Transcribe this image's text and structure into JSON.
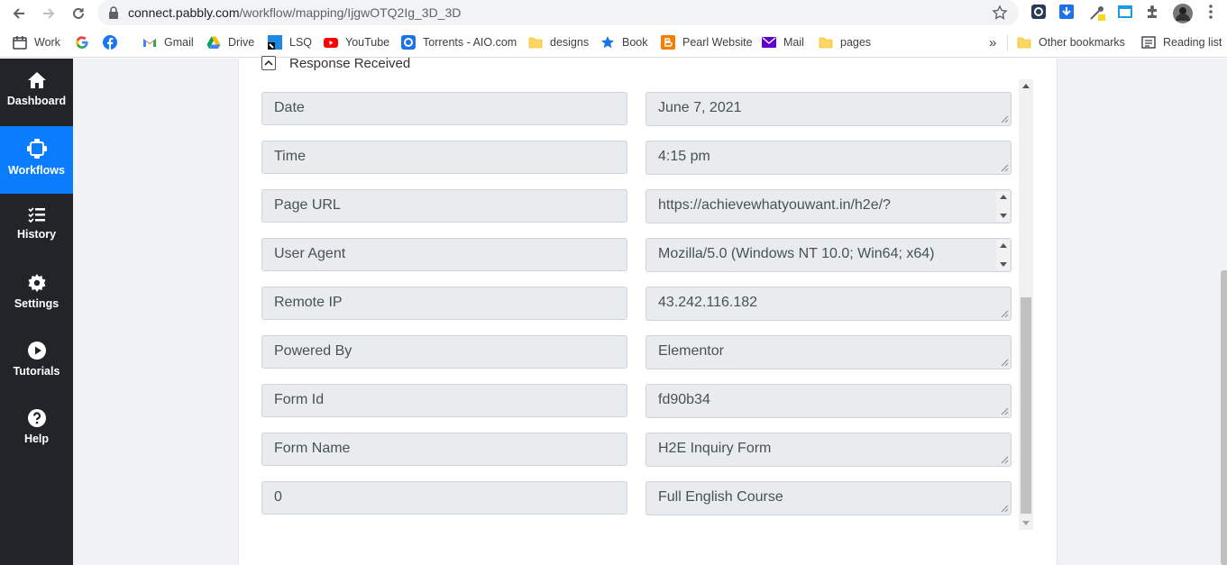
{
  "browser": {
    "url_host": "connect.pabbly.com",
    "url_path": "/workflow/mapping/IjgwOTQ2Ig_3D_3D",
    "bookmarks": [
      {
        "label": "Work",
        "icon": "calendar-icon"
      },
      {
        "label": "",
        "icon": "google-icon"
      },
      {
        "label": "",
        "icon": "facebook-icon"
      },
      {
        "label": "Gmail",
        "icon": "gmail-icon"
      },
      {
        "label": "Drive",
        "icon": "drive-icon"
      },
      {
        "label": "LSQ",
        "icon": "lsq-icon"
      },
      {
        "label": "YouTube",
        "icon": "youtube-icon"
      },
      {
        "label": "Torrents - AIO.com",
        "icon": "torrents-icon"
      },
      {
        "label": "designs",
        "icon": "folder-icon"
      },
      {
        "label": "Book",
        "icon": "star-icon"
      },
      {
        "label": "Pearl Website",
        "icon": "blogger-icon"
      },
      {
        "label": "Mail",
        "icon": "yahoo-mail-icon"
      },
      {
        "label": "pages",
        "icon": "folder-icon"
      }
    ],
    "overflow_label": "»",
    "other_bookmarks": "Other bookmarks",
    "reading_list": "Reading list"
  },
  "sidebar": {
    "items": [
      {
        "label": "Dashboard",
        "icon": "home-icon",
        "active": false
      },
      {
        "label": "Workflows",
        "icon": "workflow-icon",
        "active": true
      },
      {
        "label": "History",
        "icon": "history-list-icon",
        "active": false
      },
      {
        "label": "Settings",
        "icon": "gear-icon",
        "active": false
      },
      {
        "label": "Tutorials",
        "icon": "play-circle-icon",
        "active": false
      },
      {
        "label": "Help",
        "icon": "help-circle-icon",
        "active": false
      }
    ]
  },
  "response": {
    "header": "Response Received",
    "fields": [
      {
        "key": "Date",
        "value": "June 7, 2021"
      },
      {
        "key": "Time",
        "value": "4:15 pm"
      },
      {
        "key": "Page URL",
        "value": "https://achievewhatyouwant.in/h2e/?"
      },
      {
        "key": "User Agent",
        "value": "Mozilla/5.0 (Windows NT 10.0; Win64; x64)"
      },
      {
        "key": "Remote IP",
        "value": "43.242.116.182"
      },
      {
        "key": "Powered By",
        "value": "Elementor"
      },
      {
        "key": "Form Id",
        "value": "fd90b34"
      },
      {
        "key": "Form Name",
        "value": "H2E Inquiry Form"
      },
      {
        "key": "0",
        "value": "Full English Course"
      }
    ]
  },
  "colors": {
    "sidebar_bg": "#212529",
    "active_accent": "#0a7cff",
    "field_bg": "#e9ecef",
    "page_bg": "#f0f2f5"
  }
}
